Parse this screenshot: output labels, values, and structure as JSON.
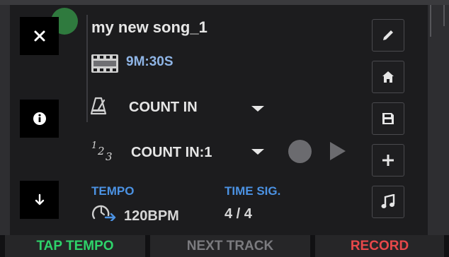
{
  "song": {
    "title": "my new song_1",
    "duration": "9M:30S"
  },
  "count_in": {
    "label": "COUNT IN",
    "bars_label": "COUNT IN:1"
  },
  "tempo": {
    "caption": "TEMPO",
    "value": "120BPM"
  },
  "time_signature": {
    "caption": "TIME SIG.",
    "value": "4 / 4"
  },
  "footer": {
    "tap_tempo": "TAP TEMPO",
    "next_track": "NEXT TRACK",
    "record": "RECORD"
  },
  "colors": {
    "accent_blue": "#4b92e3",
    "duration_blue": "#8fb5e6",
    "tap_tempo_green": "#2ed36a",
    "record_red": "#e8484a",
    "next_track_gray": "#7b7b7f"
  },
  "icons": {
    "left_column": [
      "close-icon",
      "info-icon",
      "arrow-down-icon"
    ],
    "right_column": [
      "pencil-icon",
      "home-icon",
      "save-icon",
      "plus-icon",
      "music-note-icon"
    ],
    "rows": [
      "film-icon",
      "metronome-icon",
      "numbers-icon",
      "tempo-icon"
    ]
  }
}
